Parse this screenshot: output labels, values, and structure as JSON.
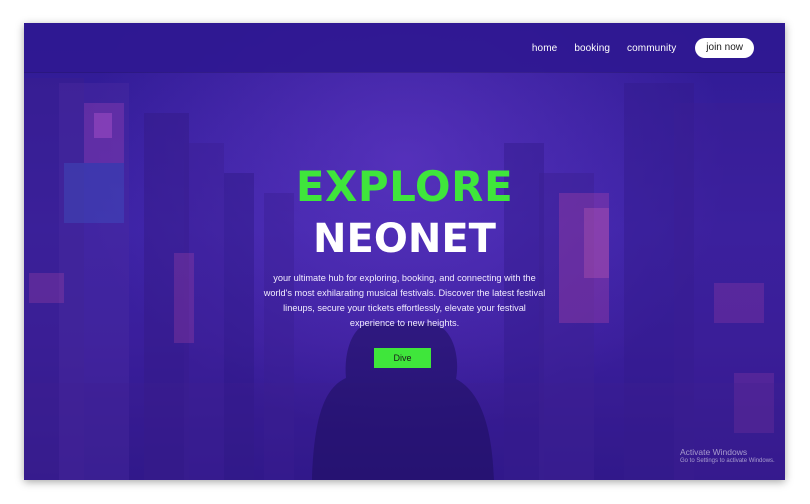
{
  "nav": {
    "items": [
      {
        "label": "home"
      },
      {
        "label": "booking"
      },
      {
        "label": "community"
      }
    ],
    "join_label": "join now"
  },
  "hero": {
    "title_line1": "EXPLORE",
    "title_line2": "NEONET",
    "description": "your ultimate hub for exploring, booking, and connecting with the world's most exhilarating musical festivals. Discover the latest festival lineups, secure your tickets effortlessly, elevate your festival experience to new heights.",
    "cta_label": "Dive"
  },
  "watermark": {
    "line1": "Activate Windows",
    "line2": "Go to Settings to activate Windows."
  },
  "colors": {
    "background": "#2f1a93",
    "accent_green": "#3fe63b",
    "button_white": "#ffffff"
  }
}
